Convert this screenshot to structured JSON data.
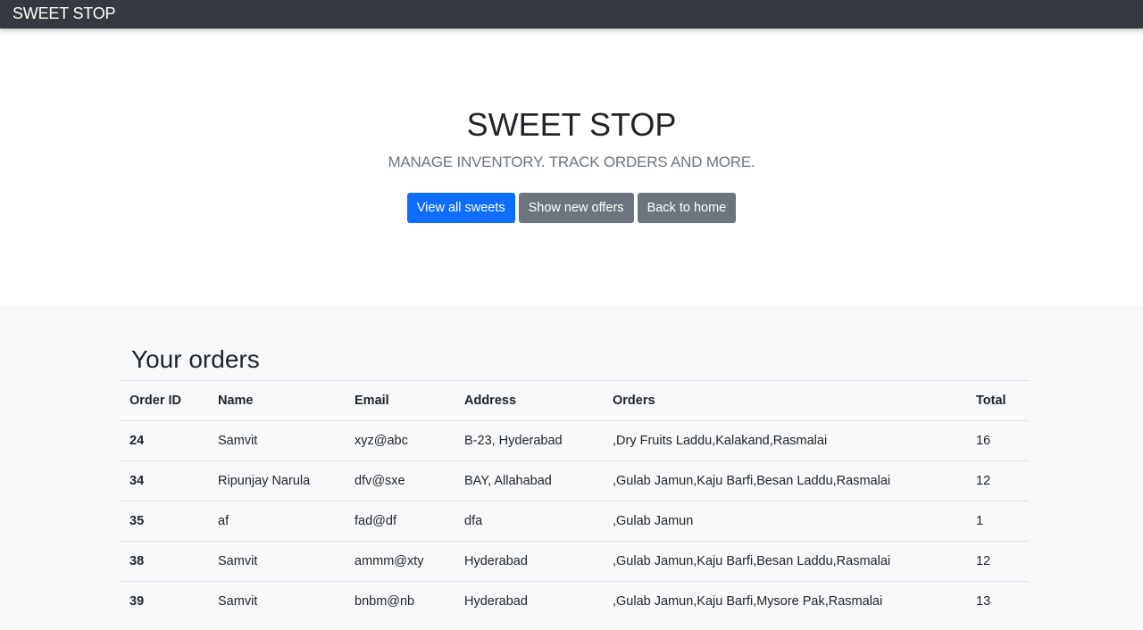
{
  "navbar": {
    "brand": "SWEET STOP"
  },
  "hero": {
    "title": "SWEET STOP",
    "subtitle": "MANAGE INVENTORY. TRACK ORDERS AND MORE.",
    "buttons": {
      "view_all": "View all sweets",
      "show_offers": "Show new offers",
      "back_home": "Back to home"
    }
  },
  "orders": {
    "heading": "Your orders",
    "columns": [
      "Order ID",
      "Name",
      "Email",
      "Address",
      "Orders",
      "Total"
    ],
    "rows": [
      {
        "id": "24",
        "name": "Samvit",
        "email": "xyz@abc",
        "address": "B-23, Hyderabad",
        "orders": ",Dry Fruits Laddu,Kalakand,Rasmalai",
        "total": "16"
      },
      {
        "id": "34",
        "name": "Ripunjay Narula",
        "email": "dfv@sxe",
        "address": "BAY, Allahabad",
        "orders": ",Gulab Jamun,Kaju Barfi,Besan Laddu,Rasmalai",
        "total": "12"
      },
      {
        "id": "35",
        "name": "af",
        "email": "fad@df",
        "address": "dfa",
        "orders": ",Gulab Jamun",
        "total": "1"
      },
      {
        "id": "38",
        "name": "Samvit",
        "email": "ammm@xty",
        "address": "Hyderabad",
        "orders": ",Gulab Jamun,Kaju Barfi,Besan Laddu,Rasmalai",
        "total": "12"
      },
      {
        "id": "39",
        "name": "Samvit",
        "email": "bnbm@nb",
        "address": "Hyderabad",
        "orders": ",Gulab Jamun,Kaju Barfi,Mysore Pak,Rasmalai",
        "total": "13"
      }
    ]
  },
  "colors": {
    "navbar_bg": "#343a40",
    "primary": "#0d6efd",
    "secondary": "#6c757d",
    "section_bg": "#f8f9fa"
  }
}
